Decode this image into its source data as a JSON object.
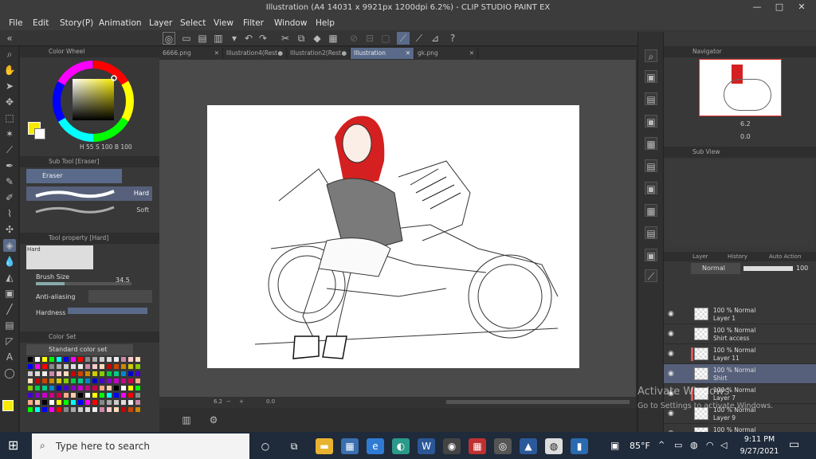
{
  "window": {
    "title": "Illustration (A4 14031 x 9921px 1200dpi 6.2%) - CLIP STUDIO PAINT EX",
    "minimize": "—",
    "maximize": "□",
    "close": "✕"
  },
  "menu": [
    "File",
    "Edit",
    "Story(P)",
    "Animation",
    "Layer",
    "Select",
    "View",
    "Filter",
    "Window",
    "Help"
  ],
  "doc_tabs": [
    {
      "label": "6666.png",
      "state": "✕"
    },
    {
      "label": "Illustration4(Rest",
      "state": "●"
    },
    {
      "label": "Illustration2(Rest",
      "state": "●"
    },
    {
      "label": "Illustration",
      "state": "✕"
    },
    {
      "label": "gk.png",
      "state": "✕"
    }
  ],
  "color_wheel": {
    "header": "Color Wheel",
    "h": "H",
    "s": "55",
    "s_label": "S",
    "b": "100",
    "b_label": "B",
    "v": "100",
    "main_color": "#f7ea00",
    "sub_color": "#ffffff"
  },
  "sub_tool": {
    "header": "Sub Tool [Eraser]",
    "group": "Eraser",
    "items": [
      "Hard",
      "Soft"
    ]
  },
  "tool_property": {
    "header": "Tool property [Hard]",
    "preset": "Hard",
    "brush_size_label": "Brush Size",
    "brush_size_value": "34.5",
    "antialias_label": "Anti-aliasing",
    "hardness_label": "Hardness"
  },
  "color_set": {
    "header": "Color Set",
    "set_name": "Standard color set"
  },
  "status": {
    "zoom": "6.2",
    "angle": "0.0"
  },
  "navigator": {
    "header": "Navigator",
    "zoom": "6.2",
    "angle": "0.0"
  },
  "sub_view": {
    "header": "Sub View"
  },
  "layer_panel": {
    "tabs": [
      "Layer",
      "History",
      "Auto Action"
    ],
    "blend_mode": "Normal",
    "opacity": "100",
    "layers": [
      {
        "mode": "100 % Normal",
        "name": "Layer 1",
        "selected": false,
        "color": false
      },
      {
        "mode": "100 % Normal",
        "name": "Shirt access",
        "selected": false,
        "color": false
      },
      {
        "mode": "100 % Normal",
        "name": "Layer 11",
        "selected": false,
        "color": true
      },
      {
        "mode": "100 % Normal",
        "name": "Shirt",
        "selected": true,
        "color": false
      },
      {
        "mode": "100 % Normal",
        "name": "Layer 7",
        "selected": false,
        "color": true
      },
      {
        "mode": "100 % Normal",
        "name": "Layer 9",
        "selected": false,
        "color": false
      },
      {
        "mode": "100 % Normal",
        "name": "",
        "selected": false,
        "color": false
      }
    ]
  },
  "activation": {
    "title": "Activate Windows",
    "sub": "Go to Settings to activate Windows."
  },
  "taskbar": {
    "search_placeholder": "Type here to search",
    "temperature": "85°F",
    "time": "9:11 PM",
    "date": "9/27/2021",
    "apps": [
      "task-view",
      "file-explorer",
      "store",
      "edge-legacy",
      "edge",
      "word",
      "app-circle",
      "app-grid",
      "app-swirl",
      "photos",
      "clip-studio",
      "clip-studio-2"
    ]
  }
}
